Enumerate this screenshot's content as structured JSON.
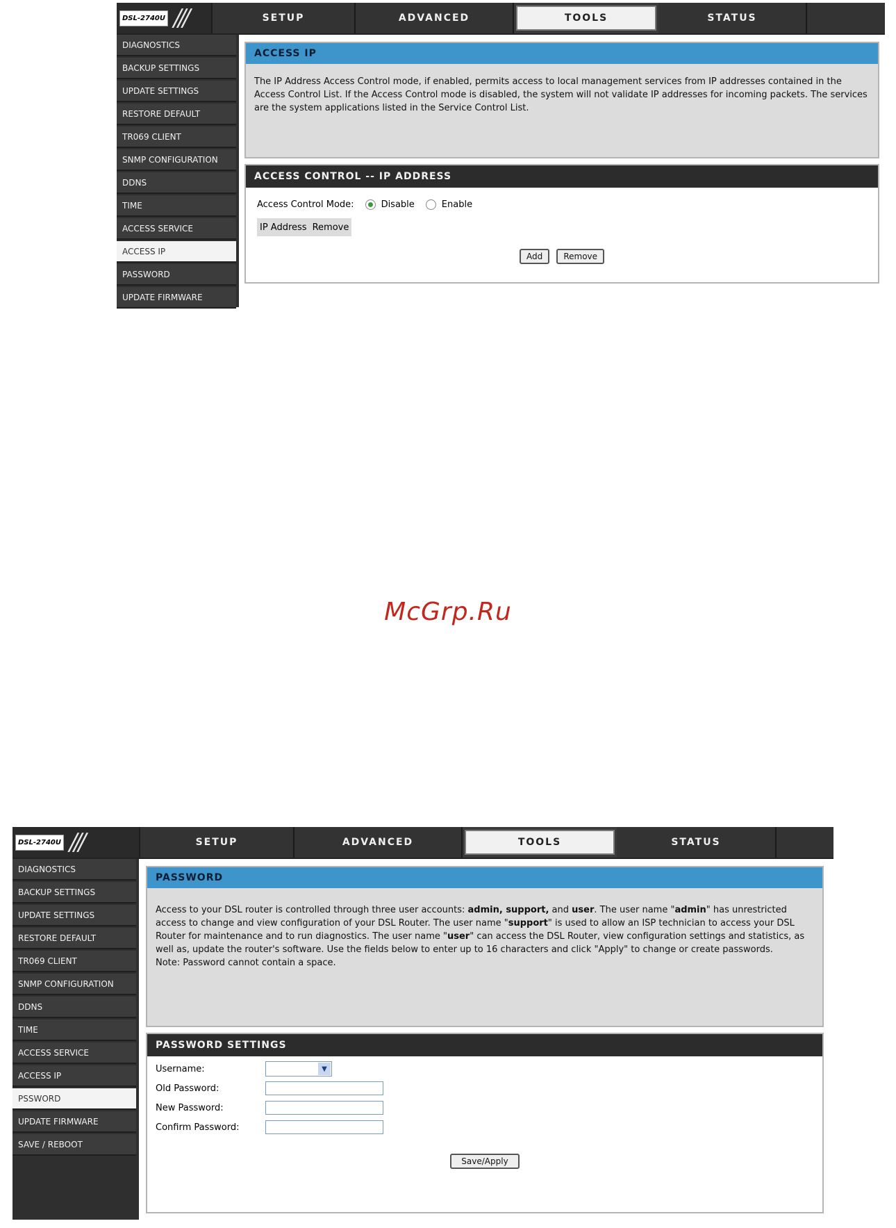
{
  "nav": {
    "logo": "DSL-2740U",
    "logo_slashes": "///",
    "tabs": [
      "SETUP",
      "ADVANCED",
      "TOOLS",
      "STATUS"
    ],
    "active_tab": "TOOLS"
  },
  "sidebar1": [
    "DIAGNOSTICS",
    "BACKUP SETTINGS",
    "UPDATE SETTINGS",
    "RESTORE DEFAULT",
    "TR069 CLIENT",
    "SNMP CONFIGURATION",
    "DDNS",
    "TIME",
    "ACCESS SERVICE",
    "ACCESS IP",
    "PASSWORD",
    "UPDATE FIRMWARE"
  ],
  "sidebar2": [
    "DIAGNOSTICS",
    "BACKUP SETTINGS",
    "UPDATE SETTINGS",
    "RESTORE DEFAULT",
    "TR069 CLIENT",
    "SNMP CONFIGURATION",
    "DDNS",
    "TIME",
    "ACCESS SERVICE",
    "ACCESS IP",
    "PSSWORD",
    "UPDATE FIRMWARE",
    "SAVE / REBOOT"
  ],
  "access_ip": {
    "title": "ACCESS IP",
    "description": "The IP Address Access Control mode, if enabled, permits access to local management services from IP addresses contained in the Access Control List. If the Access Control mode is disabled, the system will not validate IP addresses for incoming packets. The services are the system applications listed in the Service Control List.",
    "section_title": "ACCESS CONTROL -- IP ADDRESS",
    "mode_label": "Access Control Mode:",
    "disable_label": "Disable",
    "enable_label": "Enable",
    "col_ip": "IP Address",
    "col_remove": "Remove",
    "add_button": "Add",
    "remove_button": "Remove"
  },
  "watermark": "McGrp.Ru",
  "password": {
    "title": "PASSWORD",
    "desc_p1": "Access to your DSL router is controlled through three user accounts: ",
    "acc_list": "admin, support,",
    "desc_and": " and ",
    "acc_user": "user",
    "desc_p2": ". The user name \"",
    "name_admin": "admin",
    "desc_p3": "\" has unrestricted access to change and view configuration of your DSL Router. The user name \"",
    "name_support": "support",
    "desc_p4": "\" is used to allow an ISP technician to access your DSL Router for maintenance and to run diagnostics. The user name \"",
    "name_user": "user",
    "desc_p5": "\" can access the DSL Router, view configuration settings and statistics, as well as, update the router's software. Use the fields below to enter up to 16 characters and click \"Apply\" to change or create passwords.",
    "note": "Note: Password cannot contain a space.",
    "section_title": "PASSWORD SETTINGS",
    "username_label": "Username:",
    "old_label": "Old Password:",
    "new_label": "New Password:",
    "confirm_label": "Confirm Password:",
    "save_button": "Save/Apply"
  }
}
